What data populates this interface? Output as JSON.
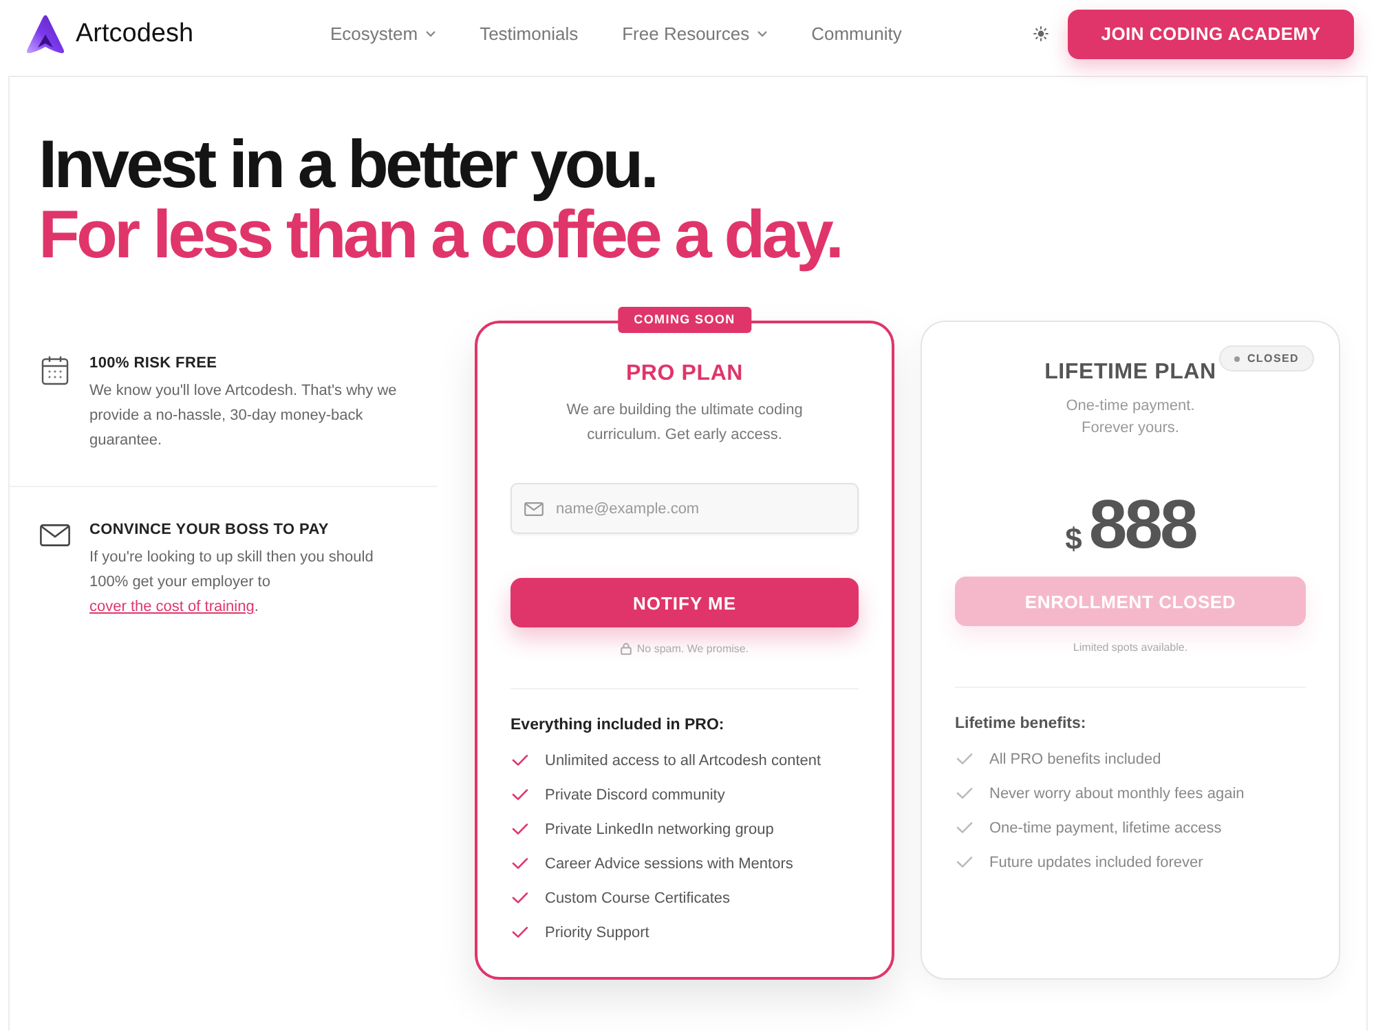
{
  "header": {
    "brand": "Artcodesh",
    "nav": [
      {
        "label": "Ecosystem",
        "dropdown": true
      },
      {
        "label": "Testimonials",
        "dropdown": false
      },
      {
        "label": "Free Resources",
        "dropdown": true
      },
      {
        "label": "Community",
        "dropdown": false
      }
    ],
    "cta": "JOIN CODING ACADEMY"
  },
  "hero": {
    "title": "Invest in a better you.",
    "subtitle": "For less than a coffee a day."
  },
  "features": [
    {
      "kind": "guarantee",
      "title": "100% RISK FREE",
      "text": "We know you'll love Artcodesh. That's why we provide a no-hassle, 30-day money-back guarantee."
    },
    {
      "kind": "sponsorship",
      "title": "CONVINCE YOUR BOSS TO PAY",
      "text": "If you're looking to up skill then you should 100% get your employer to",
      "link": "cover the cost of training",
      "text_end": "."
    }
  ],
  "plans": [
    {
      "kind": "waitlist",
      "featured": true,
      "badge": "COMING SOON",
      "title": "PRO PLAN",
      "description": "We are building the ultimate coding curriculum. Get early access.",
      "email_placeholder": "name@example.com",
      "button": "NOTIFY ME",
      "button_disabled": false,
      "note": "No spam. We promise.",
      "list_title": "Everything included in PRO:",
      "benefits": [
        "Unlimited access to all Artcodesh content",
        "Private Discord community",
        "Private LinkedIn networking group",
        "Career Advice sessions with Mentors",
        "Custom Course Certificates",
        "Priority Support"
      ]
    },
    {
      "kind": "price",
      "featured": false,
      "status": "CLOSED",
      "title": "LIFETIME PLAN",
      "description": "One-time payment. Forever yours.",
      "currency": "$",
      "price": "888",
      "button": "ENROLLMENT CLOSED",
      "button_disabled": true,
      "note": "Limited spots available.",
      "list_title": "Lifetime benefits:",
      "benefits": [
        "All PRO benefits included",
        "Never worry about monthly fees again",
        "One-time payment, lifetime access",
        "Future updates included forever"
      ]
    }
  ]
}
